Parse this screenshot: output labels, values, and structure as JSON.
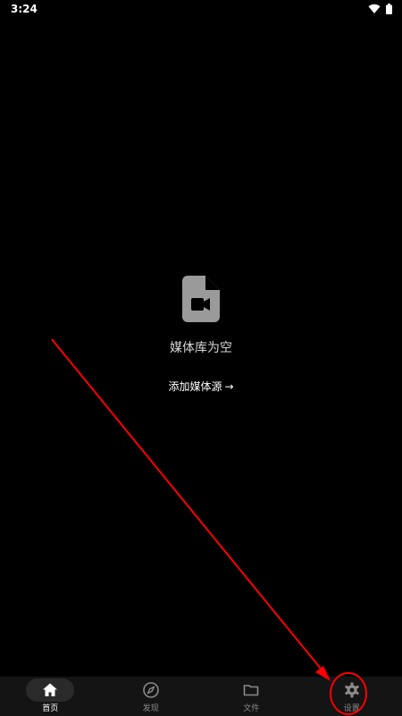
{
  "status_bar": {
    "time": "3:24",
    "icons": [
      "wifi-icon",
      "battery-icon"
    ]
  },
  "empty_state": {
    "icon": "video-file-icon",
    "message": "媒体库为空",
    "action_label": "添加媒体源",
    "action_arrow": "→"
  },
  "bottom_nav": {
    "items": [
      {
        "label": "首页",
        "icon": "home-icon",
        "active": true
      },
      {
        "label": "发现",
        "icon": "compass-icon",
        "active": false
      },
      {
        "label": "文件",
        "icon": "folder-icon",
        "active": false
      },
      {
        "label": "设置",
        "icon": "gear-icon",
        "active": false
      }
    ]
  },
  "colors": {
    "background": "#000000",
    "nav_background": "#141414",
    "active_pill": "#2a2a2a",
    "icon_gray": "#8a8a8a",
    "annotation_red": "#ff0000"
  }
}
